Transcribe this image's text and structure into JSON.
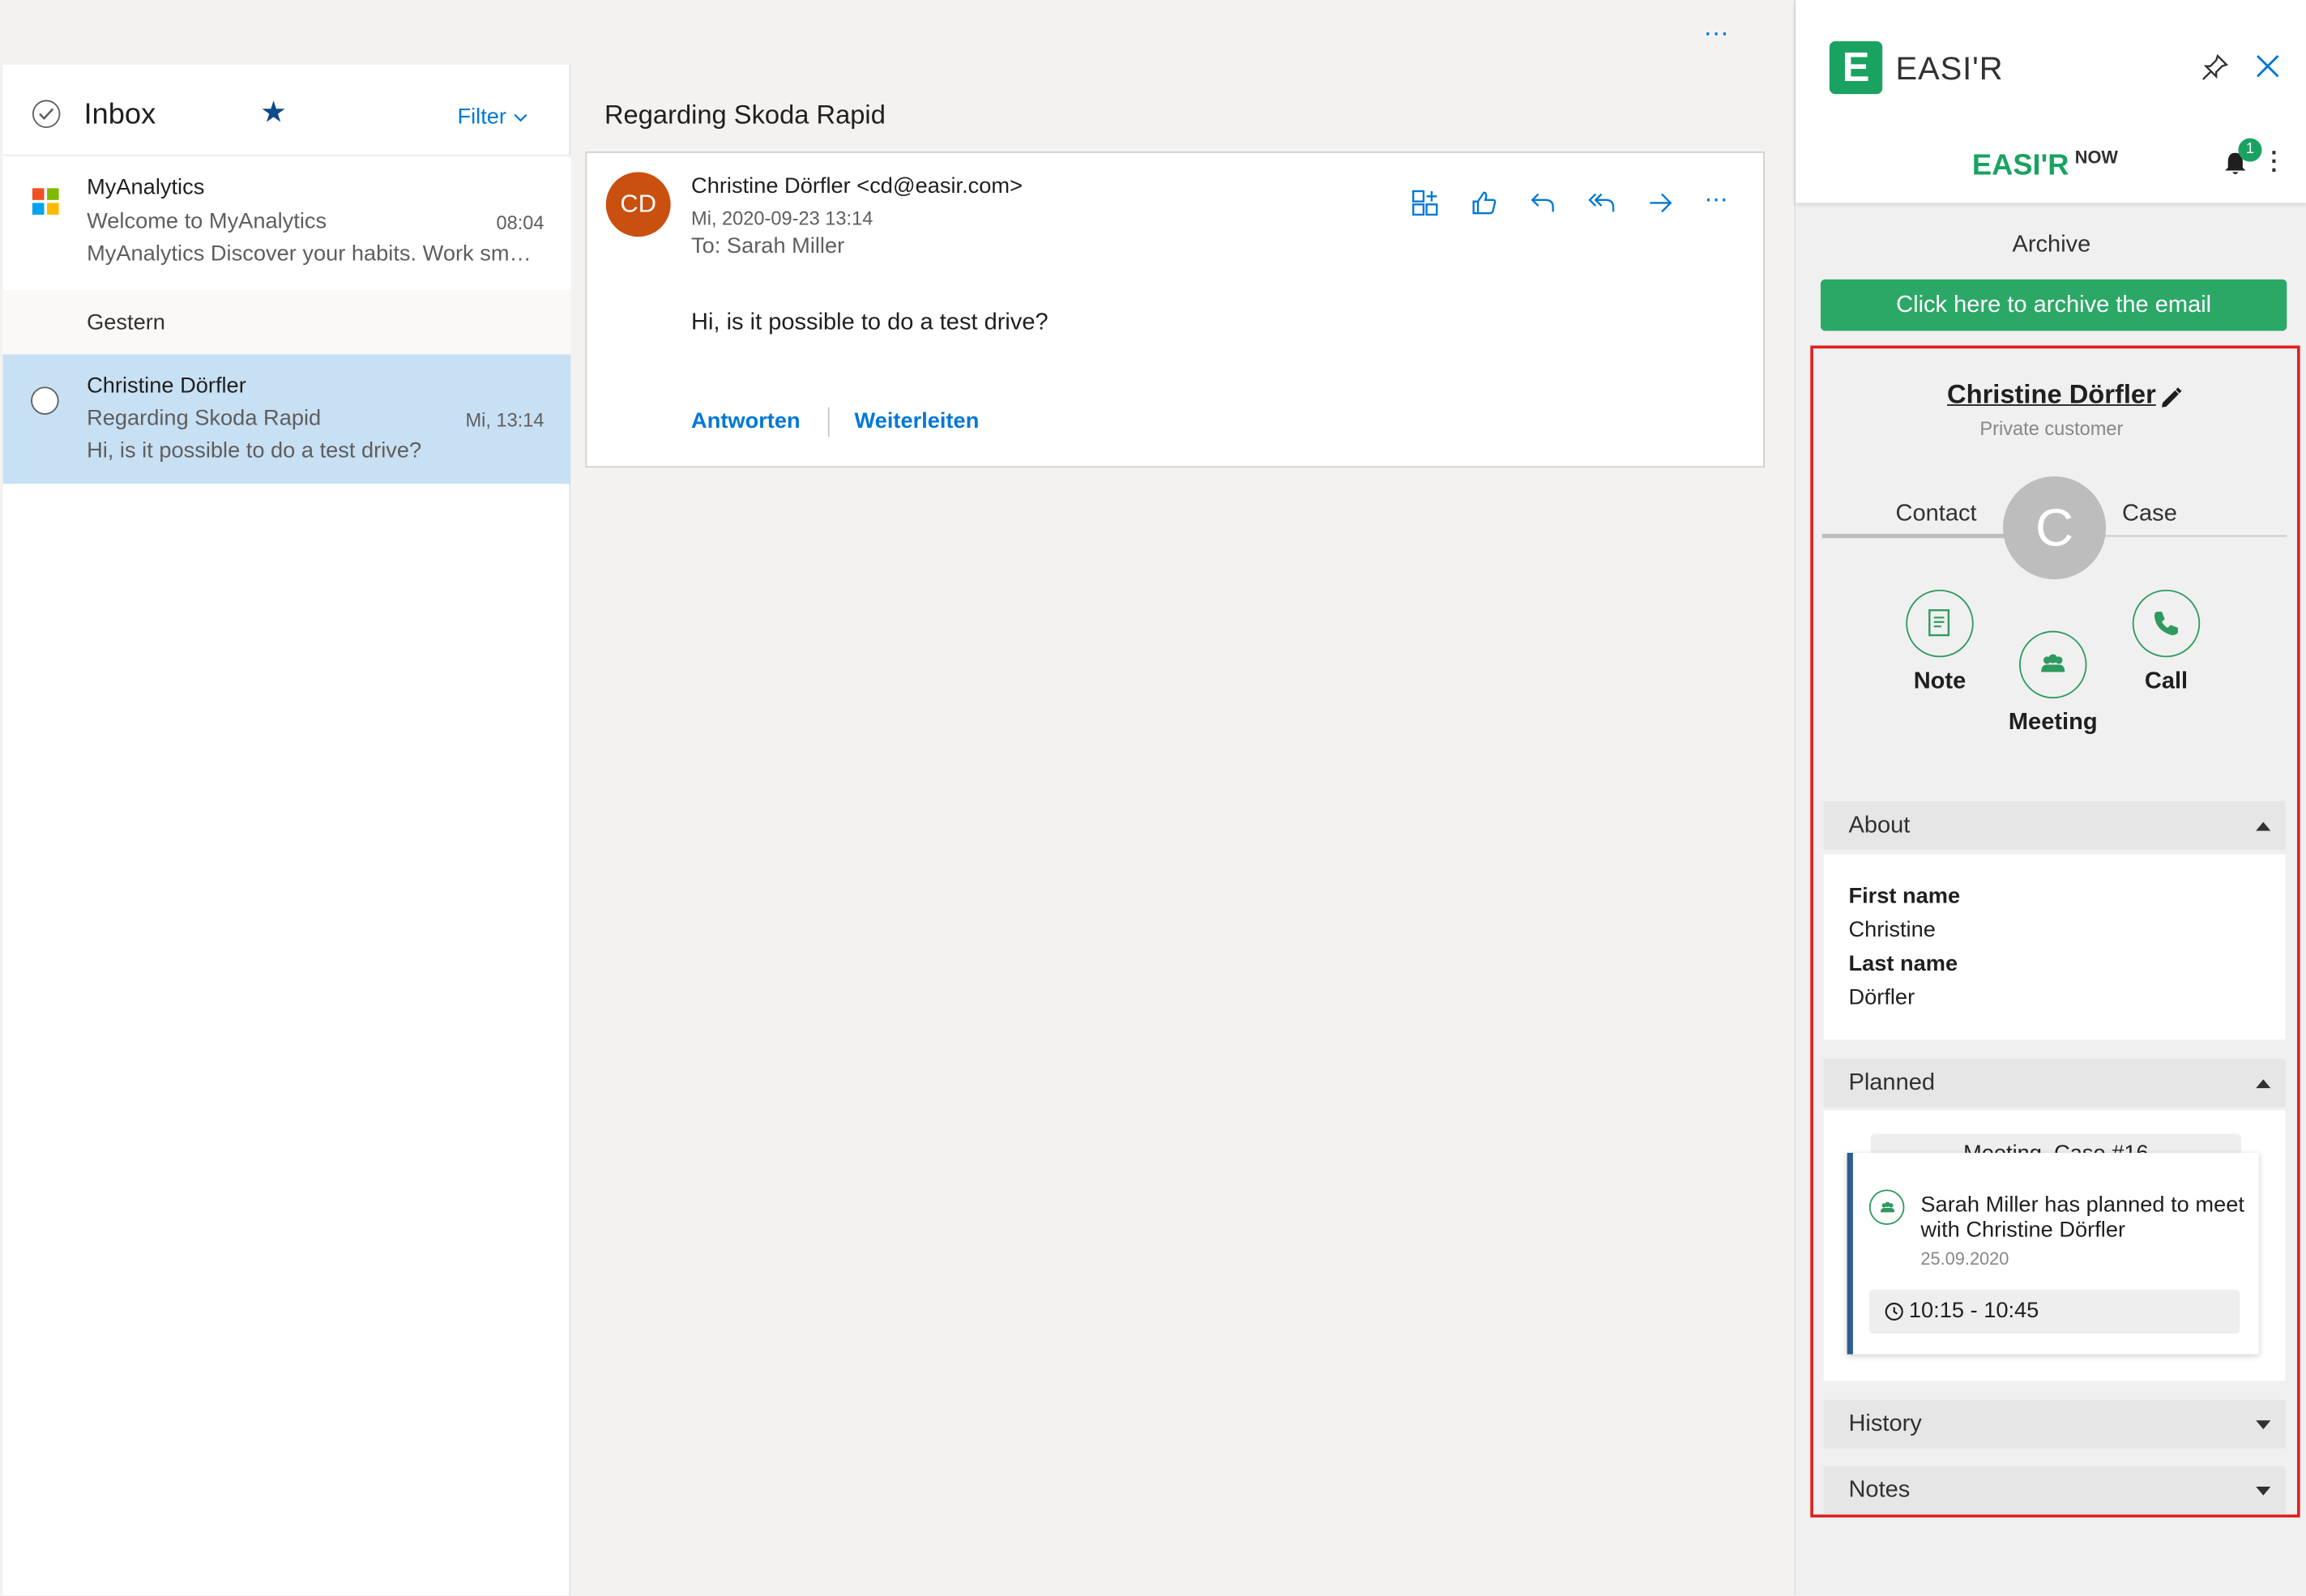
{
  "topbar": {
    "more_label": "…"
  },
  "message_list": {
    "title": "Inbox",
    "filter_label": "Filter",
    "items": [
      {
        "sender": "MyAnalytics",
        "subject": "Welcome to MyAnalytics",
        "time": "08:04",
        "preview": "MyAnalytics Discover your habits. Work sm…"
      },
      {
        "sender": "Christine Dörfler",
        "subject": "Regarding Skoda Rapid",
        "time": "Mi, 13:14",
        "preview": "Hi, is it possible to do a test drive?"
      }
    ],
    "group_label": "Gestern"
  },
  "reading": {
    "subject": "Regarding Skoda Rapid",
    "avatar_initials": "CD",
    "from": "Christine Dörfler <cd@easir.com>",
    "date": "Mi, 2020-09-23 13:14",
    "to": "To: Sarah Miller",
    "body": "Hi, is it possible to do a test drive?",
    "reply_label": "Antworten",
    "forward_label": "Weiterleiten",
    "more_label": "⋯"
  },
  "easir": {
    "app_name": "EASI'R",
    "logo_letter": "E",
    "now_brand": "EASI'R",
    "now_suffix": "NOW",
    "notification_count": "1",
    "archive_label": "Archive",
    "archive_button": "Click here to archive the email",
    "contact_name": "Christine Dörfler",
    "contact_type": "Private customer",
    "tabs": {
      "contact": "Contact",
      "case": "Case"
    },
    "avatar_initial": "C",
    "actions": {
      "note": "Note",
      "meeting": "Meeting",
      "call": "Call"
    },
    "sections": {
      "about": "About",
      "planned": "Planned",
      "history": "History",
      "notes": "Notes"
    },
    "about": {
      "first_name_label": "First name",
      "first_name": "Christine",
      "last_name_label": "Last name",
      "last_name": "Dörfler"
    },
    "planned": {
      "tag": "Meeting, Case #16",
      "text": "Sarah Miller has planned to meet with Christine Dörfler",
      "date": "25.09.2020",
      "time": "10:15 - 10:45"
    }
  },
  "colors": {
    "outlook_blue": "#0078d4",
    "easir_green": "#1aa260",
    "selected_row": "#c7e0f4",
    "highlight_frame": "#e02020"
  }
}
